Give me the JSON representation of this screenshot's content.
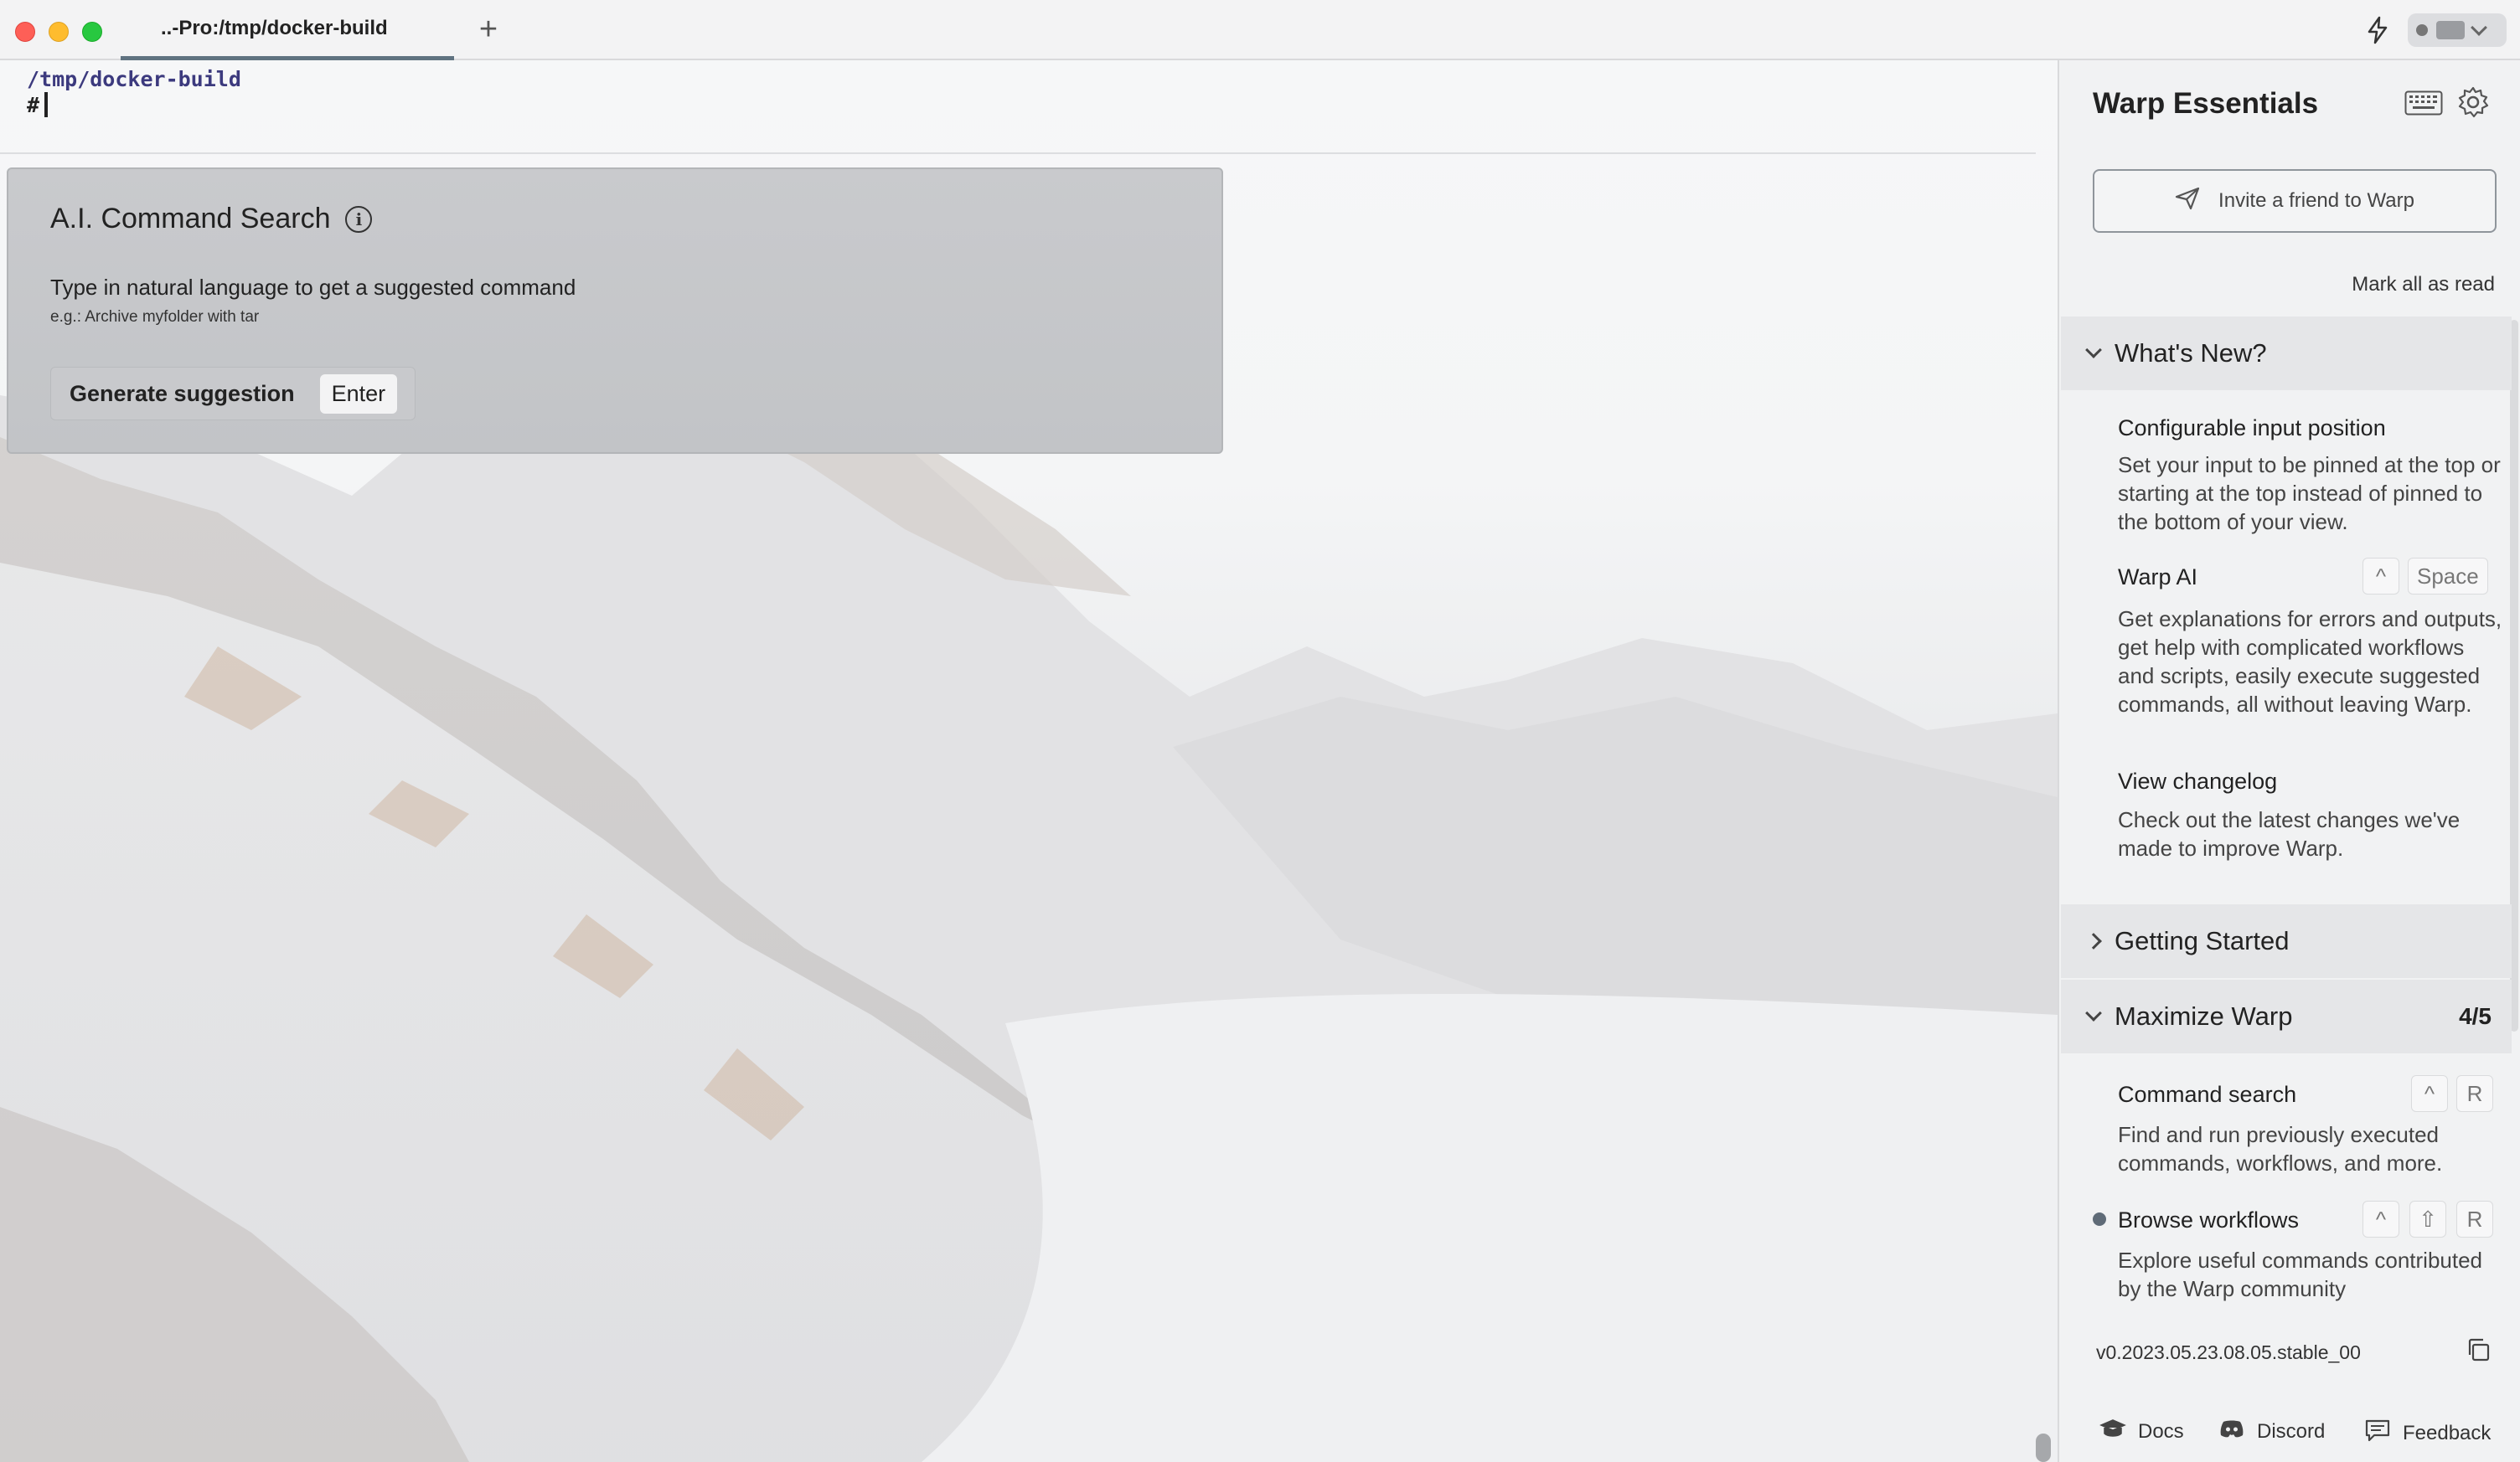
{
  "window": {
    "tab_title": "..-Pro:/tmp/docker-build",
    "new_tab_symbol": "+"
  },
  "terminal": {
    "cwd": "/tmp/docker-build",
    "prompt_symbol": "#"
  },
  "ai_command_search": {
    "title": "A.I. Command Search",
    "info_icon_glyph": "i",
    "description": "Type in natural language to get a suggested command",
    "example": "e.g.: Archive myfolder with tar",
    "generate_label": "Generate suggestion",
    "enter_key": "Enter"
  },
  "sidebar": {
    "title": "Warp Essentials",
    "invite_label": "Invite a friend to Warp",
    "mark_all_read": "Mark all as read",
    "whats_new": {
      "heading": "What's New?",
      "items": [
        {
          "title": "Configurable input position",
          "desc": "Set your input to be pinned at the top or starting at the top instead of pinned to the bottom of your view."
        },
        {
          "title": "Warp AI",
          "keys": [
            "^",
            "Space"
          ],
          "desc": "Get explanations for errors and outputs, get help with complicated workflows and scripts, easily execute suggested commands, all without leaving Warp."
        },
        {
          "title": "View changelog",
          "desc": "Check out the latest changes we've made to improve Warp."
        }
      ]
    },
    "getting_started": {
      "heading": "Getting Started"
    },
    "maximize_warp": {
      "heading": "Maximize Warp",
      "count": "4/5",
      "items": [
        {
          "title": "Command search",
          "keys": [
            "^",
            "R"
          ],
          "desc": "Find and run previously executed commands, workflows, and more."
        },
        {
          "title": "Browse workflows",
          "keys": [
            "^",
            "⇧",
            "R"
          ],
          "desc": "Explore useful commands contributed by the Warp community"
        }
      ]
    },
    "version": "v0.2023.05.23.08.05.stable_00",
    "footer": {
      "docs": "Docs",
      "discord": "Discord",
      "feedback": "Feedback"
    }
  },
  "colors": {
    "accent": "#5f7280",
    "cwd": "#3c3a7e",
    "traffic_red": "#fe5f57",
    "traffic_yellow": "#febc2e",
    "traffic_green": "#28c840"
  }
}
